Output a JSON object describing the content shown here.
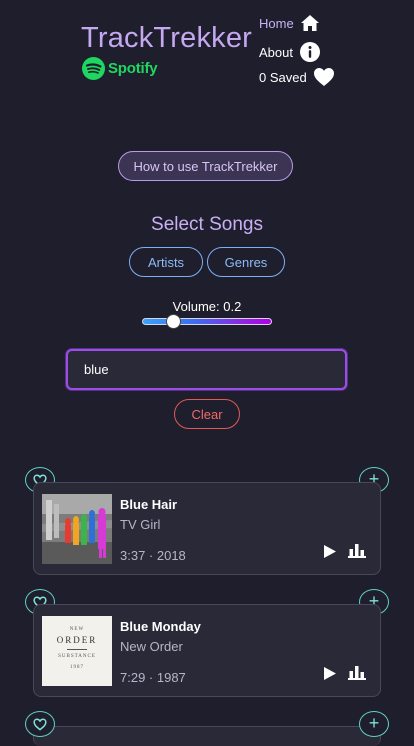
{
  "header": {
    "title": "TrackTrekker",
    "spotify_label": "Spotify",
    "nav": {
      "home": "Home",
      "about": "About",
      "saved": "0 Saved"
    }
  },
  "how_to_button": "How to use TrackTrekker",
  "select": {
    "heading": "Select Songs",
    "artists_label": "Artists",
    "genres_label": "Genres"
  },
  "volume": {
    "label": "Volume: 0.2",
    "value": 0.2
  },
  "search": {
    "value": "blue"
  },
  "clear_label": "Clear",
  "songs": [
    {
      "title": "Blue Hair",
      "artist": "TV Girl",
      "meta": "3:37 · 2018"
    },
    {
      "title": "Blue Monday",
      "artist": "New Order",
      "meta": "7:29 · 1987"
    }
  ],
  "cover_text": {
    "new_order_line1": "NEW",
    "new_order_line2": "ORDER",
    "new_order_line3": "SUBSTANCE",
    "new_order_line4": "1987"
  },
  "colors": {
    "background": "#1f1e2c",
    "accent_purple": "#c4a8f0",
    "spotify_green": "#1ed760",
    "teal": "#5fd4c0",
    "clear_red": "#e05a58"
  }
}
